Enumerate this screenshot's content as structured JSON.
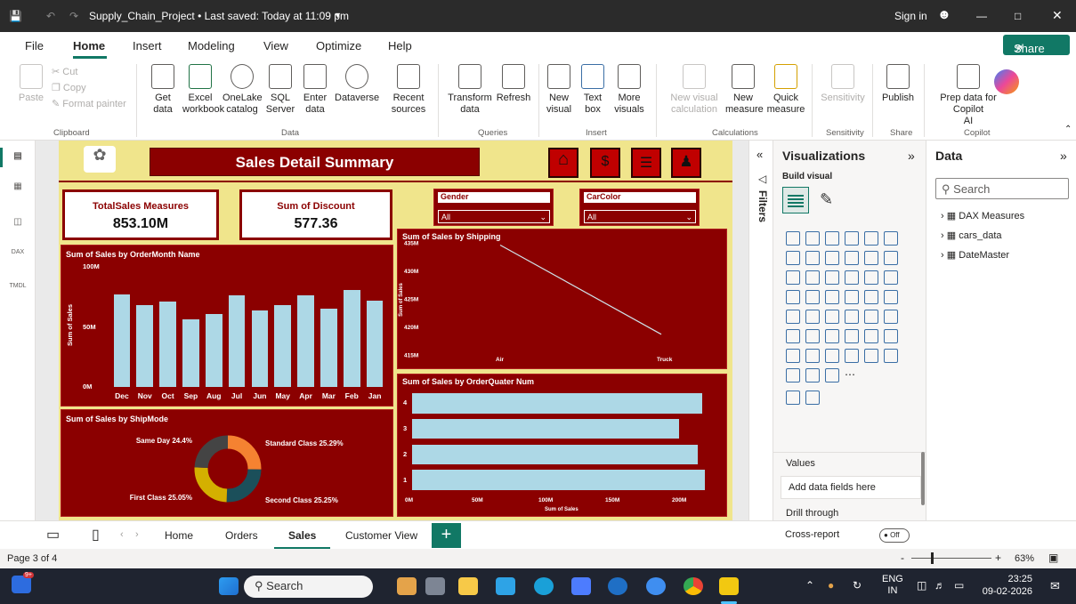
{
  "titlebar": {
    "title": "Supply_Chain_Project • Last saved: Today at 11:09 pm",
    "signin": "Sign in"
  },
  "menu": {
    "items": [
      "File",
      "Home",
      "Insert",
      "Modeling",
      "View",
      "Optimize",
      "Help"
    ],
    "active": "Home",
    "share": "Share"
  },
  "ribbon": {
    "clipboard": {
      "paste": "Paste",
      "cut": "Cut",
      "copy": "Copy",
      "format_painter": "Format painter",
      "group": "Clipboard"
    },
    "data": {
      "get_data": "Get data",
      "excel": "Excel workbook",
      "onelake": "OneLake catalog",
      "sql": "SQL Server",
      "enter": "Enter data",
      "dataverse": "Dataverse",
      "recent": "Recent sources",
      "group": "Data"
    },
    "queries": {
      "transform": "Transform data",
      "refresh": "Refresh",
      "group": "Queries"
    },
    "insert": {
      "new_visual": "New visual",
      "text_box": "Text box",
      "more_visuals": "More visuals",
      "group": "Insert"
    },
    "calculations": {
      "new_visual_calc": "New visual calculation",
      "new_measure": "New measure",
      "quick_measure": "Quick measure",
      "group": "Calculations"
    },
    "sensitivity": {
      "label": "Sensitivity",
      "group": "Sensitivity"
    },
    "share": {
      "publish": "Publish",
      "group": "Share"
    },
    "copilot": {
      "prep": "Prep data for Copilot",
      "ai": "AI",
      "group": "Copilot"
    }
  },
  "report": {
    "title": "Sales Detail Summary",
    "cards": [
      {
        "label": "TotalSales Measures",
        "value": "853.10M"
      },
      {
        "label": "Sum of Discount",
        "value": "577.36"
      }
    ],
    "slicers": [
      {
        "label": "Gender",
        "value": "All"
      },
      {
        "label": "CarColor",
        "value": "All"
      }
    ]
  },
  "chart_data": [
    {
      "type": "bar",
      "title": "Sum of Sales by OrderMonth Name",
      "ylabel": "Sum of Sales",
      "yticks": [
        "100M",
        "50M",
        "0M"
      ],
      "ylim": [
        0,
        100
      ],
      "categories": [
        "Dec",
        "Nov",
        "Oct",
        "Sep",
        "Aug",
        "Jul",
        "Jun",
        "May",
        "Apr",
        "Mar",
        "Feb",
        "Jan"
      ],
      "values": [
        77,
        68,
        71,
        56,
        61,
        76,
        64,
        68,
        76,
        65,
        81,
        72
      ]
    },
    {
      "type": "line",
      "title": "Sum of Sales by Shipping",
      "ylabel": "Sum of Sales",
      "yticks": [
        "435M",
        "430M",
        "425M",
        "420M",
        "415M"
      ],
      "ylim": [
        413.5,
        436
      ],
      "categories": [
        "Air",
        "Truck"
      ],
      "values": [
        434.5,
        418.6
      ]
    },
    {
      "type": "pie",
      "title": "Sum of Sales by ShipMode",
      "slices": [
        {
          "label": "Standard Class 25.29%",
          "value": 25.29,
          "color": "#f58231"
        },
        {
          "label": "Second Class 25.25%",
          "value": 25.25,
          "color": "#1b4f5a"
        },
        {
          "label": "First Class 25.05%",
          "value": 25.05,
          "color": "#d4b000"
        },
        {
          "label": "Same Day 24.4%",
          "value": 24.4,
          "color": "#444444"
        }
      ]
    },
    {
      "type": "bar",
      "orientation": "horizontal",
      "title": "Sum of Sales by OrderQuater Num",
      "xlabel": "Sum of Sales",
      "xticks": [
        "0M",
        "50M",
        "100M",
        "150M",
        "200M"
      ],
      "xlim": [
        0,
        210
      ],
      "categories": [
        "4",
        "3",
        "2",
        "1"
      ],
      "values": [
        217,
        200,
        214,
        219
      ]
    }
  ],
  "panes": {
    "filters": "Filters",
    "visualizations": {
      "title": "Visualizations",
      "build": "Build visual",
      "values": "Values",
      "add_fields": "Add data fields here",
      "drill": "Drill through",
      "cross_report": "Cross-report",
      "toggle": "Off"
    },
    "data": {
      "title": "Data",
      "search_placeholder": "Search",
      "tables": [
        "DAX Measures",
        "cars_data",
        "DateMaster"
      ]
    }
  },
  "tabs": {
    "items": [
      "Home",
      "Orders",
      "Sales",
      "Customer View"
    ],
    "active": "Sales"
  },
  "status": {
    "page": "Page 3 of 4",
    "zoom": "63%"
  },
  "taskbar": {
    "search": "Search",
    "lang": "ENG",
    "region": "IN",
    "time": "23:25",
    "date": "09-02-2026",
    "badge": "9+"
  }
}
